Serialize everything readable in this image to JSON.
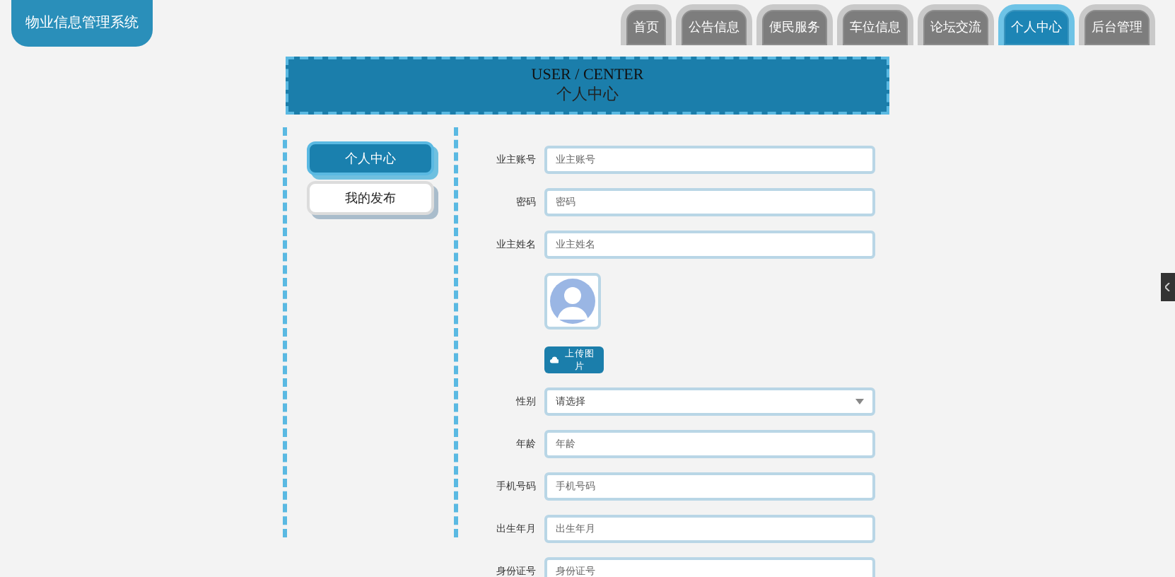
{
  "site_title": "物业信息管理系统",
  "nav": [
    {
      "label": "首页",
      "selected": false
    },
    {
      "label": "公告信息",
      "selected": false
    },
    {
      "label": "便民服务",
      "selected": false
    },
    {
      "label": "车位信息",
      "selected": false
    },
    {
      "label": "论坛交流",
      "selected": false
    },
    {
      "label": "个人中心",
      "selected": true
    },
    {
      "label": "后台管理",
      "selected": false
    }
  ],
  "banner": {
    "title": "USER / CENTER",
    "subtitle": "个人中心"
  },
  "side_menu": [
    {
      "label": "个人中心",
      "selected": true
    },
    {
      "label": "我的发布",
      "selected": false
    }
  ],
  "form": [
    {
      "kind": "text",
      "label": "业主账号",
      "placeholder": "业主账号"
    },
    {
      "kind": "text",
      "label": "密码",
      "placeholder": "密码"
    },
    {
      "kind": "text",
      "label": "业主姓名",
      "placeholder": "业主姓名"
    },
    {
      "kind": "avatar",
      "button": "上传图片"
    },
    {
      "kind": "select",
      "label": "性别",
      "value": "请选择"
    },
    {
      "kind": "text",
      "label": "年龄",
      "placeholder": "年龄"
    },
    {
      "kind": "text",
      "label": "手机号码",
      "placeholder": "手机号码"
    },
    {
      "kind": "text",
      "label": "出生年月",
      "placeholder": "出生年月"
    },
    {
      "kind": "text",
      "label": "身份证号",
      "placeholder": "身份证号"
    }
  ]
}
